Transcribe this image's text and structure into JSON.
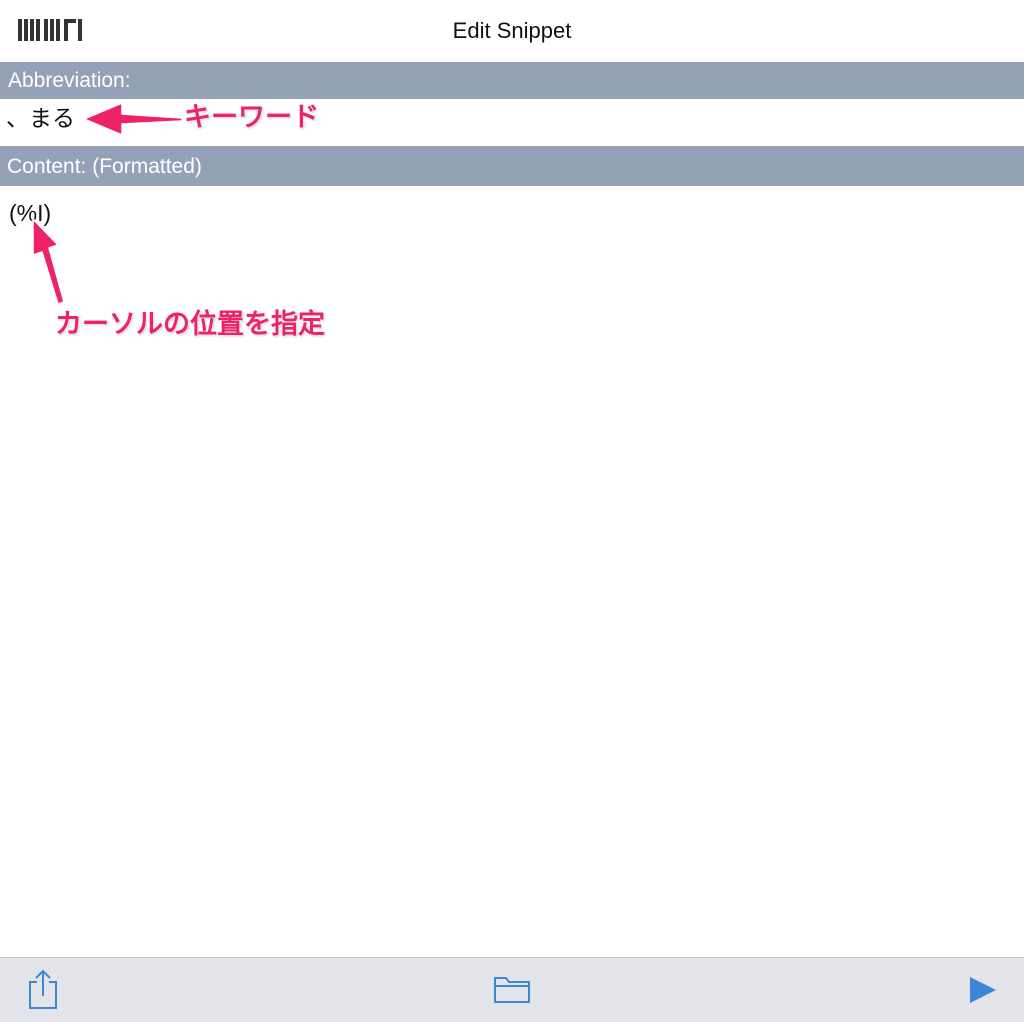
{
  "navbar": {
    "title": "Edit Snippet",
    "logo_icon": "app-logo-icon"
  },
  "abbreviation": {
    "header": "Abbreviation:",
    "value": "、まる"
  },
  "content": {
    "header": "Content: (Formatted)",
    "value": "(%I)"
  },
  "annotations": {
    "keyword_label": "キーワード",
    "cursor_label": "カーソルの位置を指定",
    "color": "#ee2266"
  },
  "toolbar": {
    "share_icon": "share-icon",
    "folder_icon": "folder-icon",
    "play_icon": "play-icon",
    "accent": "#3b87d6"
  },
  "colors": {
    "section_header": "#94a2b8",
    "toolbar_bg": "#e3e4ea"
  }
}
